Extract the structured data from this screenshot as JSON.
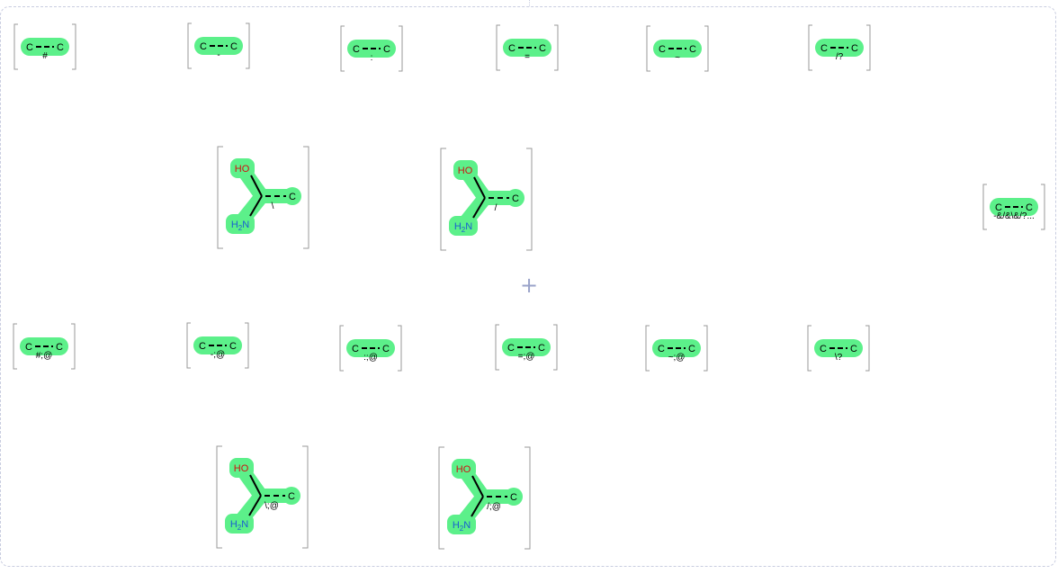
{
  "canvas": {
    "plus_symbol": "+"
  },
  "atoms": {
    "carbon": "C",
    "hydroxyl": "HO",
    "amine_h": "H",
    "amine_sub": "2",
    "amine_n": "N"
  },
  "colors": {
    "highlight": "#5cf08a",
    "bracket": "#9a9a9a",
    "oxygen": "#d01010",
    "nitrogen": "#1a5fd0",
    "frame": "#c9cde0"
  },
  "molecules": [
    {
      "id": "m1",
      "kind": "simple",
      "bond_label": "#"
    },
    {
      "id": "m2",
      "kind": "simple",
      "bond_label": "-"
    },
    {
      "id": "m3",
      "kind": "simple",
      "bond_label": ":"
    },
    {
      "id": "m4",
      "kind": "simple",
      "bond_label": "="
    },
    {
      "id": "m5",
      "kind": "simple",
      "bond_label": "~"
    },
    {
      "id": "m6",
      "kind": "simple",
      "bond_label": "/?"
    },
    {
      "id": "m7",
      "kind": "branched",
      "bond_label": "\\"
    },
    {
      "id": "m8",
      "kind": "branched",
      "bond_label": "/"
    },
    {
      "id": "m9",
      "kind": "simple",
      "bond_label": "-&/&\\&/?..."
    },
    {
      "id": "m10",
      "kind": "simple",
      "bond_label": "#;@"
    },
    {
      "id": "m11",
      "kind": "simple",
      "bond_label": "-;@"
    },
    {
      "id": "m12",
      "kind": "simple",
      "bond_label": ":;@"
    },
    {
      "id": "m13",
      "kind": "simple",
      "bond_label": "=;@"
    },
    {
      "id": "m14",
      "kind": "simple",
      "bond_label": "~;@"
    },
    {
      "id": "m15",
      "kind": "simple",
      "bond_label": "\\?"
    },
    {
      "id": "m16",
      "kind": "branched",
      "bond_label": "\\;@"
    },
    {
      "id": "m17",
      "kind": "branched",
      "bond_label": "/;@"
    }
  ]
}
